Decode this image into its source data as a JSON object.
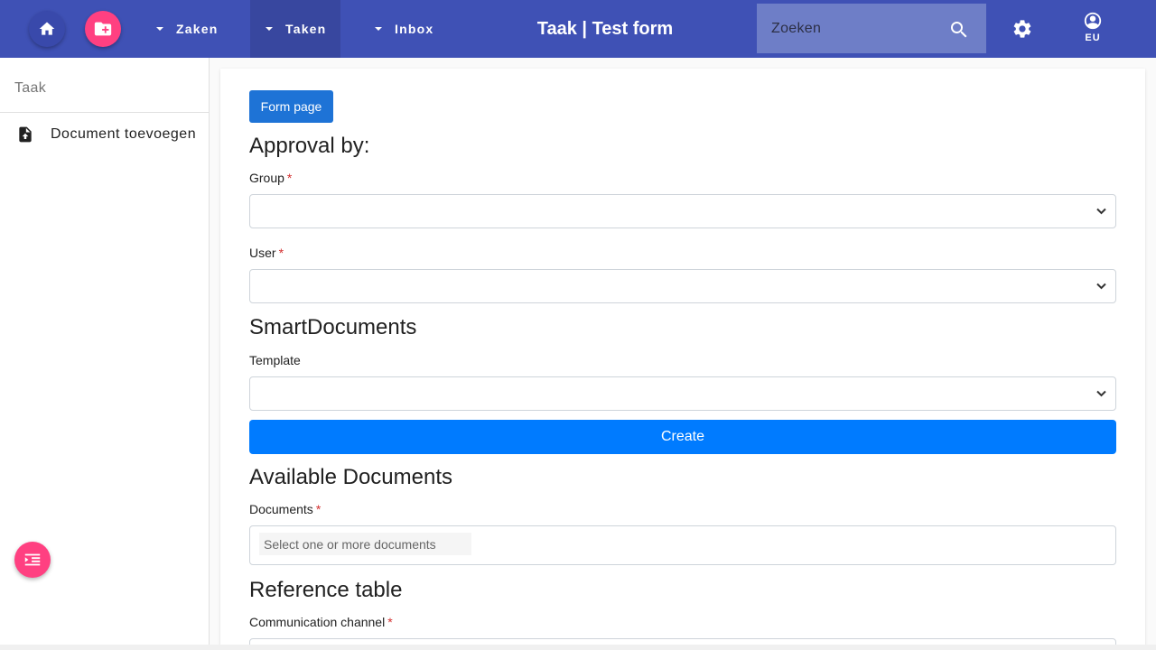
{
  "topbar": {
    "home_icon": "home-icon",
    "new_case_icon": "folder-plus-icon",
    "nav": [
      {
        "label": "Zaken"
      },
      {
        "label": "Taken"
      },
      {
        "label": "Inbox"
      }
    ],
    "title": "Taak | Test form",
    "search": {
      "placeholder": "Zoeken",
      "value": ""
    },
    "user_initials": "EU",
    "colors": {
      "primary": "#3f51b5",
      "accent": "#ff4081"
    }
  },
  "sidebar": {
    "title": "Taak",
    "items": [
      {
        "label": "Document toevoegen",
        "icon": "file-upload-icon"
      }
    ]
  },
  "form": {
    "form_page_button": "Form page",
    "approval_heading": "Approval by:",
    "group_label": "Group",
    "user_label": "User",
    "required_marker": "*",
    "smartdocs_heading": "SmartDocuments",
    "template_label": "Template",
    "create_button": "Create",
    "available_docs_heading": "Available Documents",
    "documents_label": "Documents",
    "documents_placeholder": "Select one or more documents",
    "reference_heading": "Reference table",
    "communication_label": "Communication channel",
    "colors": {
      "form_page_button": "#1e73d6",
      "create_button": "#007bff",
      "required": "#d32f2f"
    }
  }
}
